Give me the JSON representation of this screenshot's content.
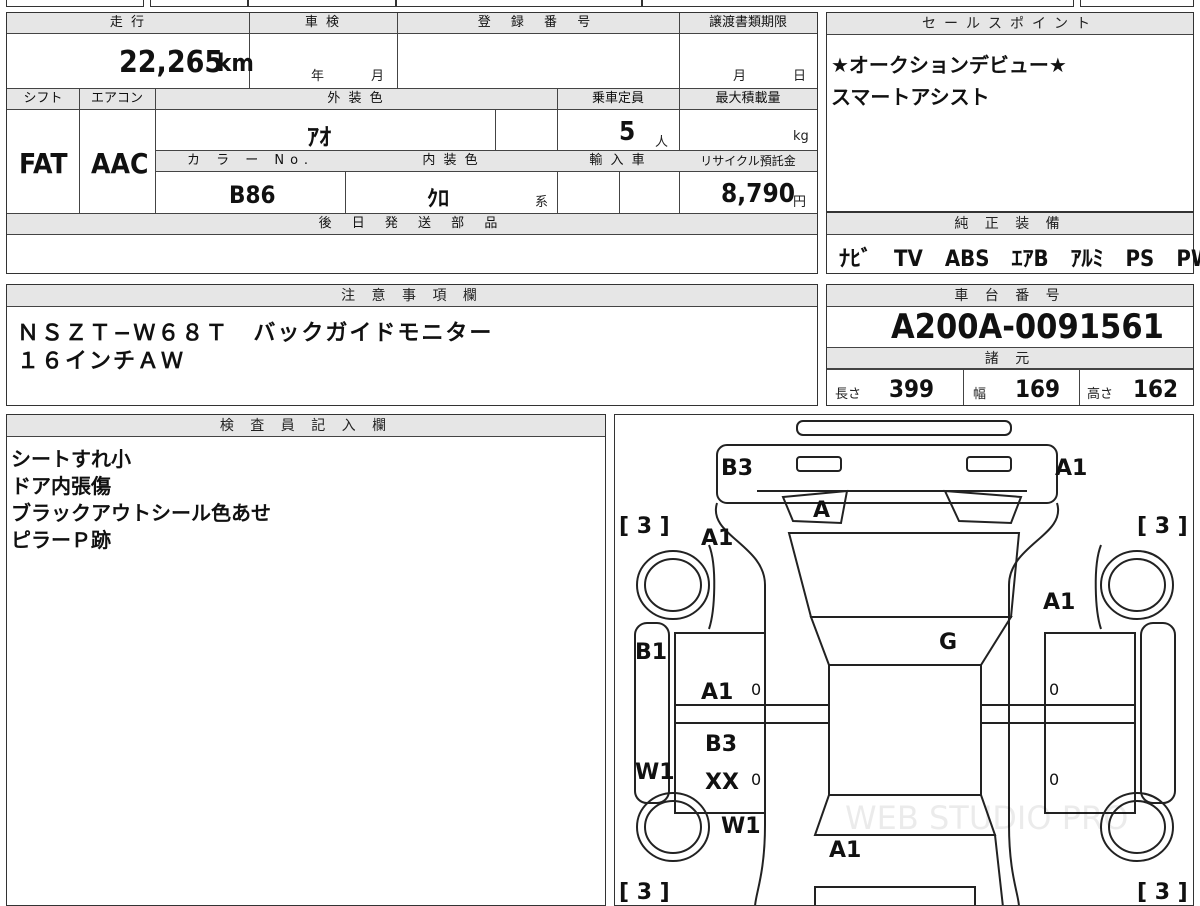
{
  "top": {
    "mileage_label": "走 行",
    "mileage_value": "22,265",
    "mileage_unit": "km",
    "inspection_label": "車 検",
    "inspection_year": "年",
    "inspection_month": "月",
    "registration_label": "登 録 番 号",
    "transfer_label": "譲渡書類期限",
    "transfer_month": "月",
    "transfer_day": "日",
    "shift_label": "シフト",
    "shift_value": "FAT",
    "ac_label": "エアコン",
    "ac_value": "AAC",
    "exterior_label": "外 装 色",
    "exterior_value": "ｱｵ",
    "capacity_label": "乗車定員",
    "capacity_value": "5",
    "capacity_unit": "人",
    "load_label": "最大積載量",
    "load_unit": "kg",
    "color_no_label": "カ ラ ー No.",
    "color_no_value": "B86",
    "interior_label": "内 装 色",
    "interior_value": "ｸﾛ",
    "interior_suffix": "系",
    "import_label": "輸 入 車",
    "recycle_label": "リサイクル預託金",
    "recycle_value": "8,790",
    "recycle_unit": "円",
    "later_parts_label": "後 日 発 送 部 品"
  },
  "sales": {
    "label": "セールスポイント",
    "lines": [
      "★オークションデビュー★",
      "スマートアシスト"
    ]
  },
  "equipment": {
    "label": "純 正 装 備",
    "items": "ﾅﾋﾞ　TV　ABS　ｴｱB　ｱﾙﾐ　PS　PW"
  },
  "notes": {
    "label": "注 意 事 項 欄",
    "lines": [
      "ＮＳＺＴ−Ｗ６８Ｔ　バックガイドモニター",
      "１６インチＡＷ"
    ]
  },
  "chassis": {
    "label": "車 台 番 号",
    "value": "A200A-0091561",
    "spec_label": "諸 元",
    "length_label": "長さ",
    "length_value": "399",
    "width_label": "幅",
    "width_value": "169",
    "height_label": "高さ",
    "height_value": "162"
  },
  "inspector": {
    "label": "検 査 員 記 入 欄",
    "lines": [
      "シートすれ小",
      "ドア内張傷",
      "ブラックアウトシール色あせ",
      "ピラーＰ跡"
    ]
  },
  "diagram": {
    "marks": [
      "B3",
      "A1",
      "A",
      "A1",
      "A1",
      "G",
      "B1",
      "A1",
      "B3",
      "XX",
      "W1",
      "W1",
      "A1"
    ],
    "tires": [
      "[ 3 ]",
      "[ 3 ]",
      "[ 3 ]",
      "[ 3 ]"
    ],
    "zeros": [
      "0",
      "0",
      "0",
      "0"
    ],
    "watermark": "WEB STUDIO PRO"
  }
}
